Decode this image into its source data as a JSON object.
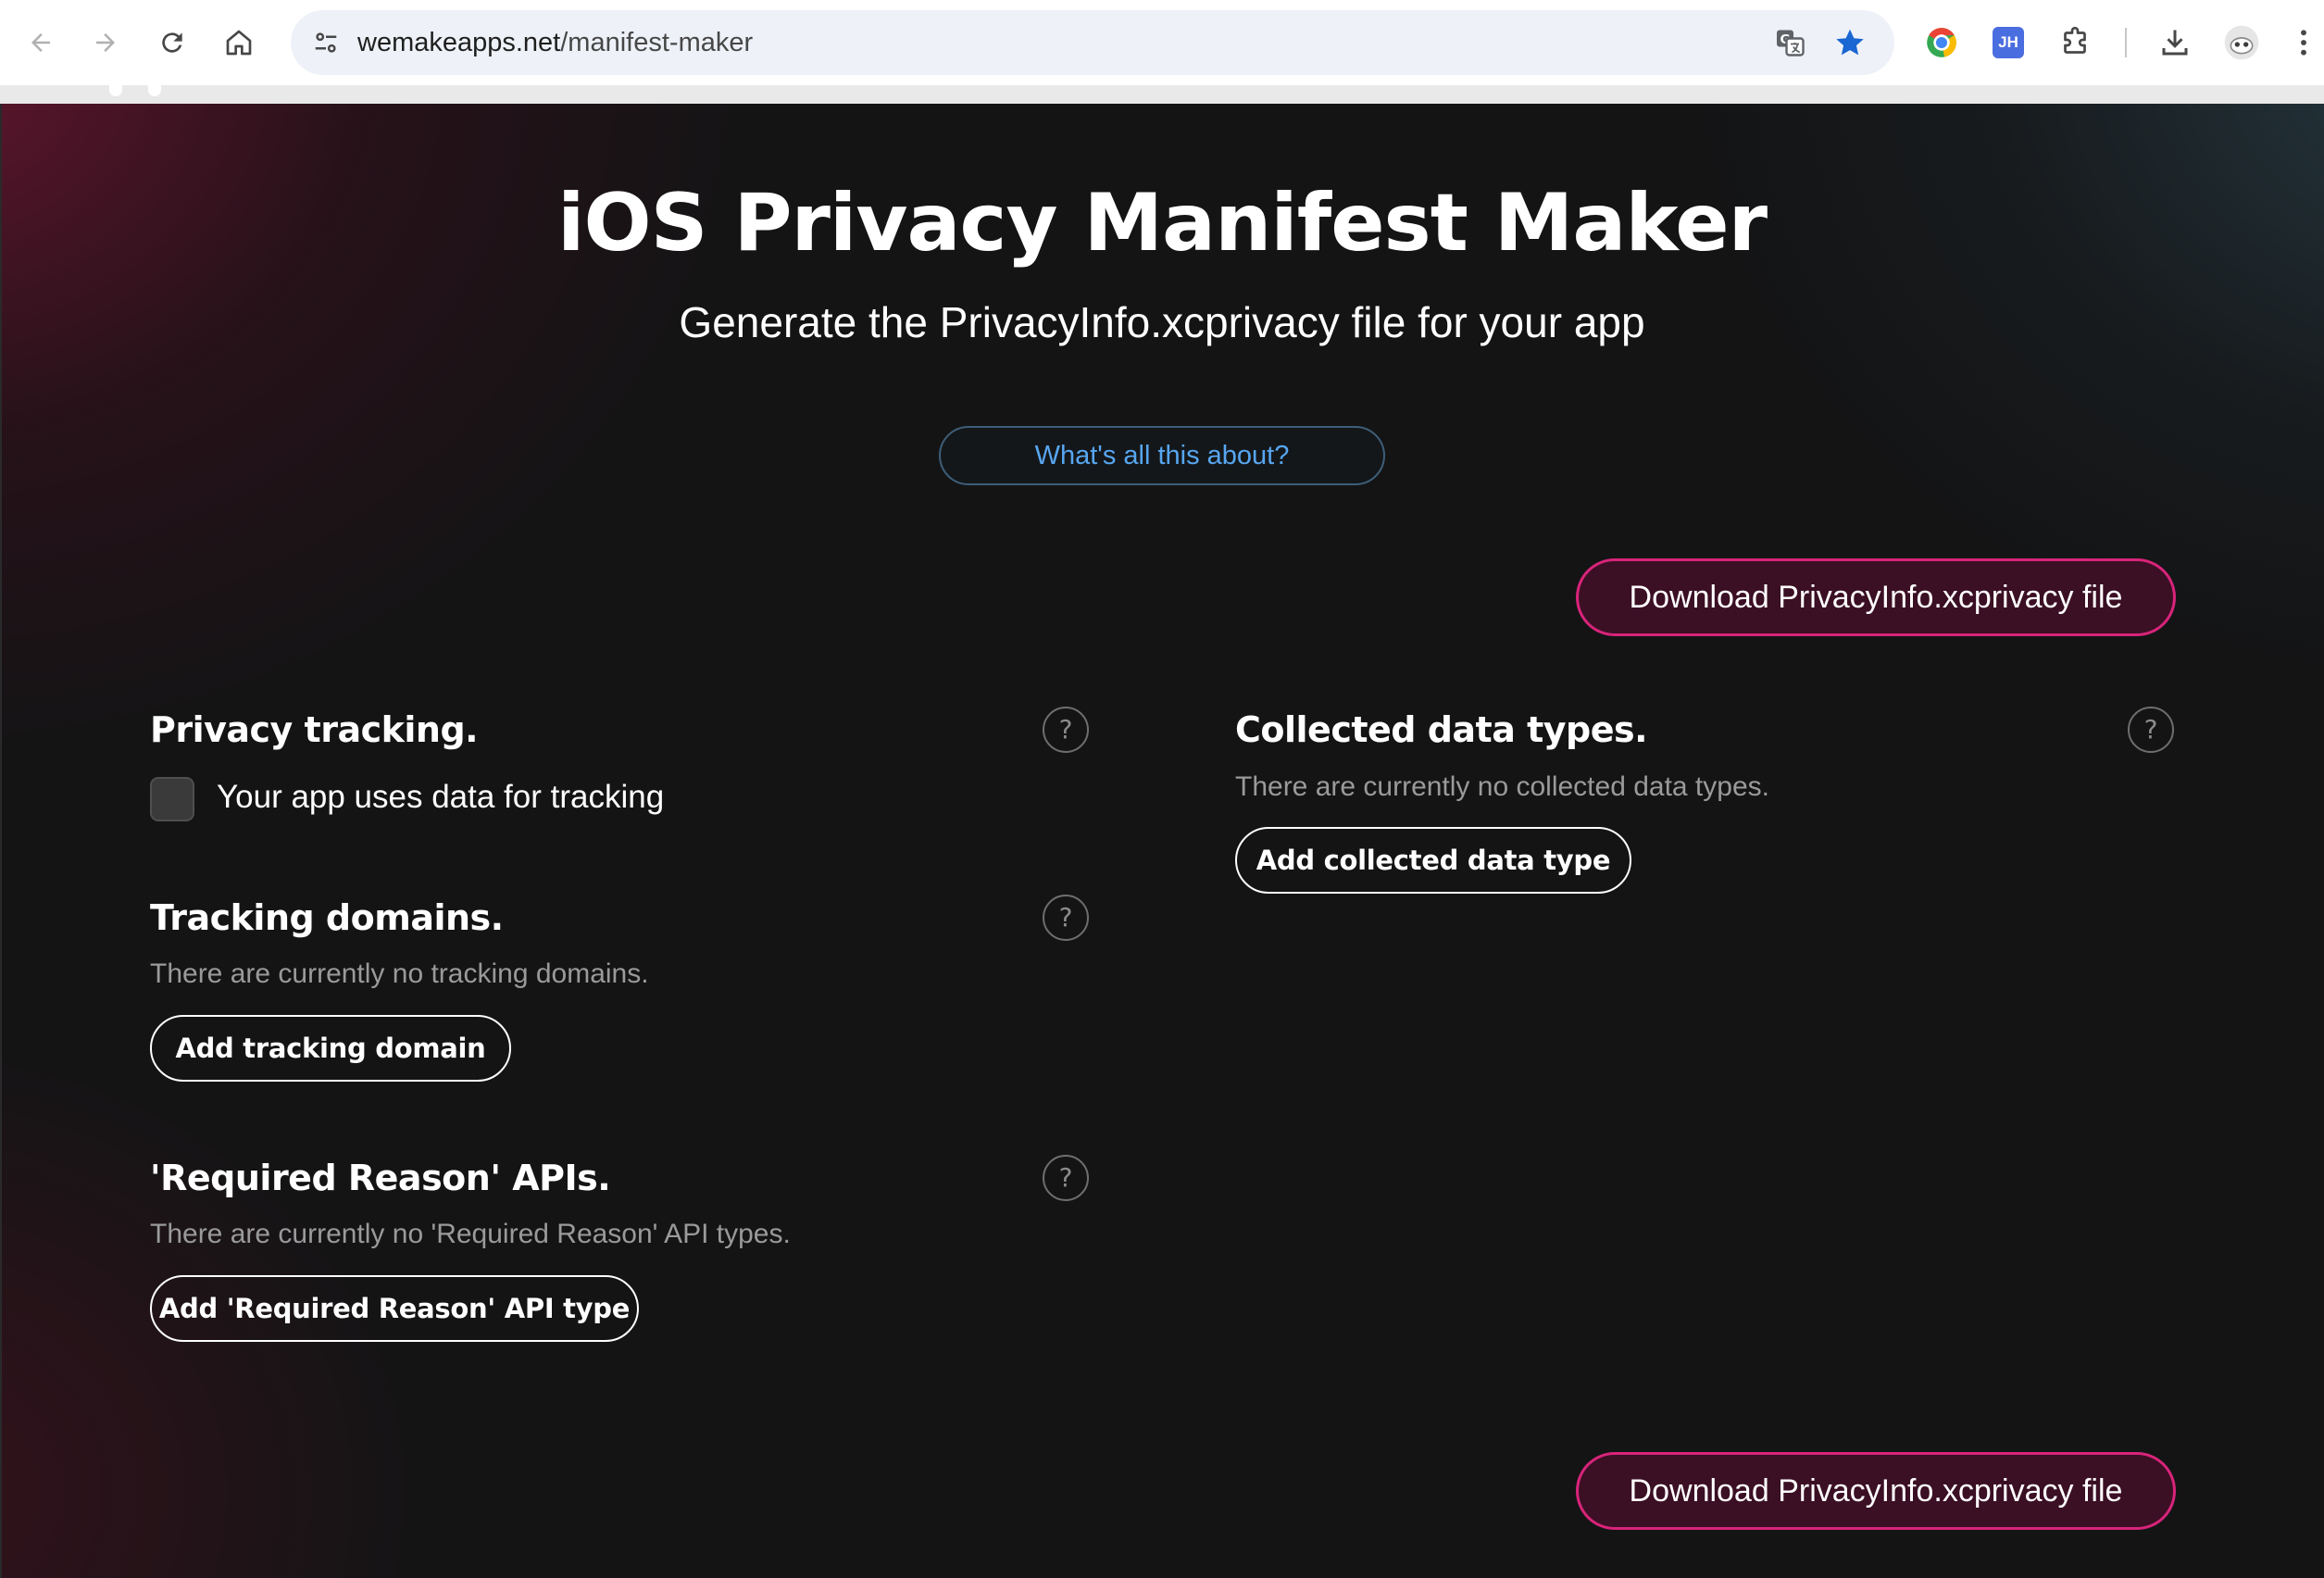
{
  "browser": {
    "url_domain": "wemakeapps.net",
    "url_path": "/manifest-maker",
    "extensions": [
      "chrome-extension-icon",
      "jh-extension-icon"
    ],
    "jh_badge": "JH"
  },
  "page": {
    "title": "iOS Privacy Manifest Maker",
    "subtitle": "Generate the PrivacyInfo.xcprivacy file for your app",
    "about_button": "What's all this about?",
    "download_button": "Download PrivacyInfo.xcprivacy file"
  },
  "privacy_tracking": {
    "title": "Privacy tracking.",
    "checkbox_label": "Your app uses data for tracking",
    "checked": false
  },
  "tracking_domains": {
    "title": "Tracking domains.",
    "empty_text": "There are currently no tracking domains.",
    "add_button": "Add tracking domain"
  },
  "required_reason_apis": {
    "title": "'Required Reason' APIs.",
    "empty_text": "There are currently no 'Required Reason' API types.",
    "add_button": "Add 'Required Reason' API type"
  },
  "collected_data_types": {
    "title": "Collected data types.",
    "empty_text": "There are currently no collected data types.",
    "add_button": "Add collected data type"
  },
  "help_glyph": "?",
  "colors": {
    "accent_pink": "#d8247a",
    "link_blue": "#57a6f0",
    "background": "#141415"
  }
}
